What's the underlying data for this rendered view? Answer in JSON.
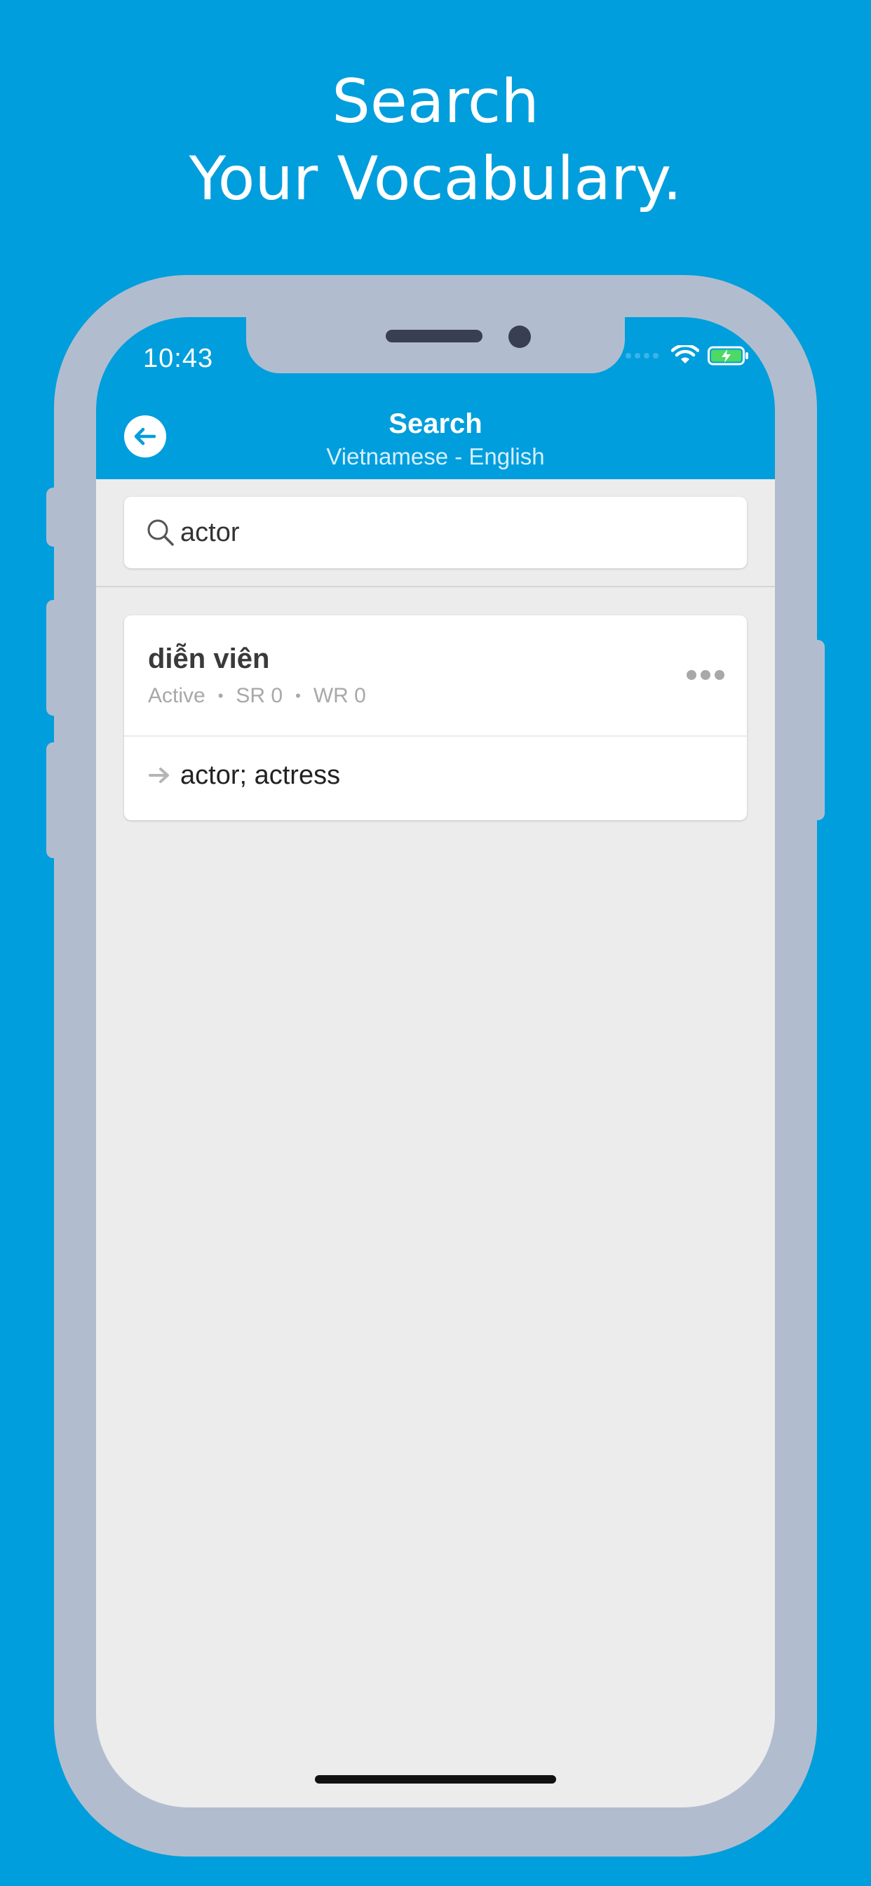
{
  "headline": {
    "line1": "Search",
    "line2": "Your Vocabulary."
  },
  "status_bar": {
    "time": "10:43"
  },
  "nav": {
    "title": "Search",
    "subtitle": "Vietnamese - English",
    "back_icon": "back-arrow-icon"
  },
  "search": {
    "value": "actor",
    "icon": "search-icon"
  },
  "results": [
    {
      "word": "diễn viên",
      "status": "Active",
      "sr": "SR 0",
      "wr": "WR 0",
      "separator": "•",
      "translation": "actor; actress"
    }
  ],
  "colors": {
    "background": "#009edc",
    "frame": "#b1bdcf",
    "screen": "#ececec",
    "battery": "#4cd964"
  }
}
